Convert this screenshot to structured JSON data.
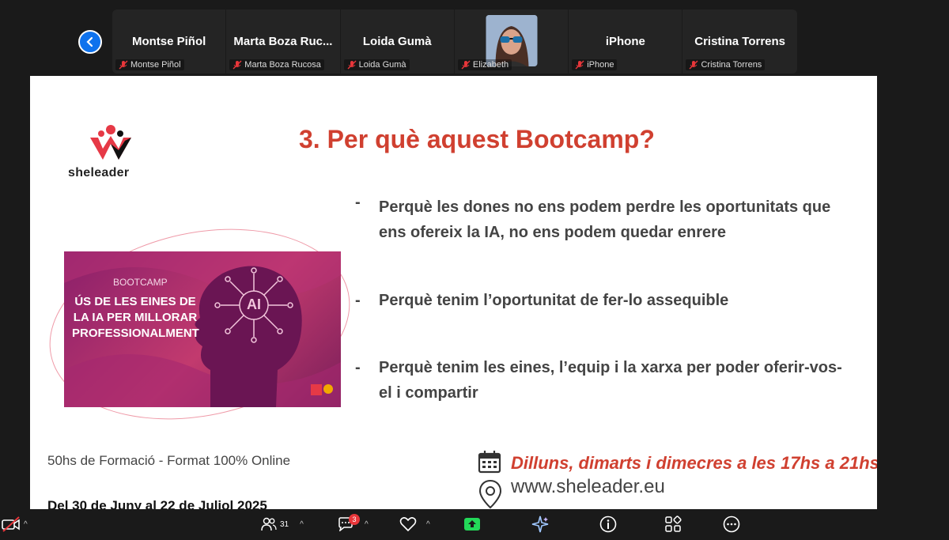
{
  "participants": [
    {
      "display": "Montse Piñol",
      "label": "Montse Piñol"
    },
    {
      "display": "Marta Boza Ruc...",
      "label": "Marta Boza Rucosa"
    },
    {
      "display": "Loida Gumà",
      "label": "Loida Gumà"
    },
    {
      "display": "",
      "label": "Elizabeth"
    },
    {
      "display": "iPhone",
      "label": "iPhone"
    },
    {
      "display": "Cristina Torrens",
      "label": "Cristina Torrens"
    }
  ],
  "slide": {
    "logo_text": "sheleader",
    "title": "3. Per què aquest Bootcamp?",
    "bullets": [
      {
        "dash": "-",
        "text": "Perquè les dones no ens podem perdre les oportunitats que ens ofereix la IA, no ens podem quedar enrere"
      },
      {
        "dash": "-",
        "text": "Perquè tenim l’oportunitat de fer-lo assequible"
      },
      {
        "dash": "-",
        "text": "Perquè tenim les eines, l’equip i la xarxa per poder oferir-vos-el i compartir"
      }
    ],
    "banner_kicker": "BOOTCAMP",
    "banner_title": "ÚS DE LES EINES DE LA IA PER MILLORAR PROFESSIONALMENT",
    "banner_ai": "AI",
    "formacio": "50hs de Formació - Format 100% Online",
    "dates": "Del 30 de Juny al 22 de Juliol 2025",
    "schedule": "Dilluns, dimarts i dimecres a les 17hs a 21hs",
    "website": "www.sheleader.eu"
  },
  "toolbar": {
    "participants_count": "31",
    "chat_badge": "3"
  },
  "colors": {
    "accent_red": "#d04030",
    "zoom_blue": "#0e72ed",
    "share_green": "#23d959"
  }
}
